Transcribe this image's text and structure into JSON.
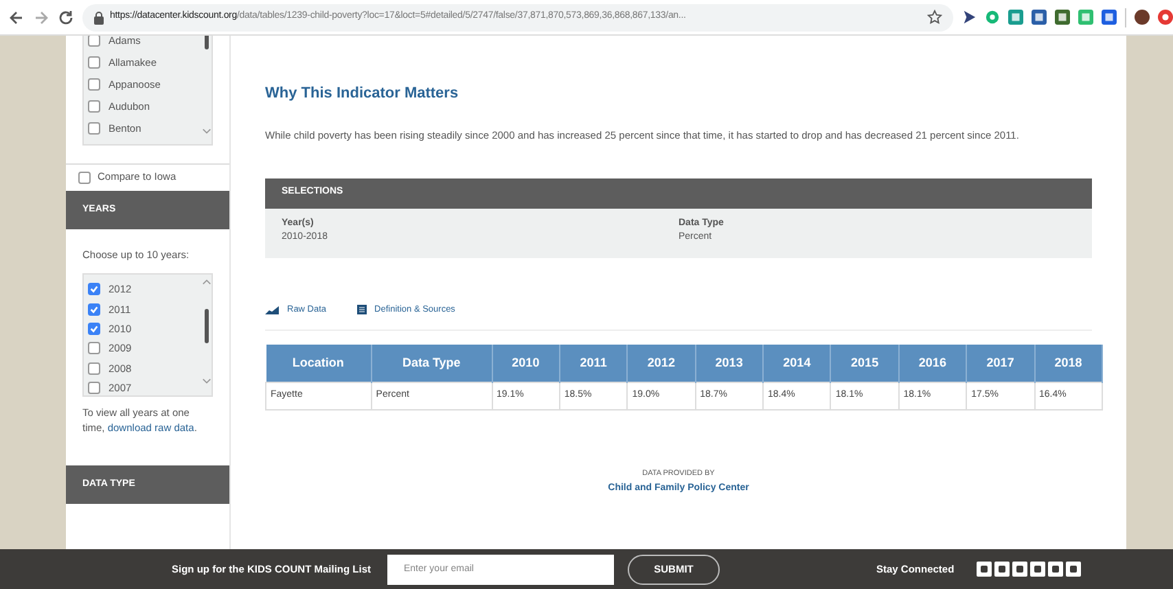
{
  "browser": {
    "url_host": "https://datacenter.kidscount.org",
    "url_path": "/data/tables/1239-child-poverty?loc=17&loct=5#detailed/5/2747/false/37,871,870,573,869,36,868,867,133/an..."
  },
  "sidebar": {
    "locations": [
      {
        "label": "Adams",
        "checked": false
      },
      {
        "label": "Allamakee",
        "checked": false
      },
      {
        "label": "Appanoose",
        "checked": false
      },
      {
        "label": "Audubon",
        "checked": false
      },
      {
        "label": "Benton",
        "checked": false
      }
    ],
    "compare": {
      "label": "Compare to Iowa",
      "checked": false
    },
    "years_header": "YEARS",
    "years_hint": "Choose up to 10 years:",
    "years": [
      {
        "label": "2012",
        "checked": true
      },
      {
        "label": "2011",
        "checked": true
      },
      {
        "label": "2010",
        "checked": true
      },
      {
        "label": "2009",
        "checked": false
      },
      {
        "label": "2008",
        "checked": false
      },
      {
        "label": "2007",
        "checked": false
      }
    ],
    "note": "To view all years at one time,",
    "note_link": "download raw data",
    "note_end": ".",
    "data_type_header": "DATA TYPE"
  },
  "main": {
    "title": "Why This Indicator Matters",
    "paragraph": "While child poverty has been rising steadily since 2000 and has increased 25 percent since that time, it has started to drop and has decreased 21 percent since 2011.",
    "selections": {
      "header": "SELECTIONS",
      "items": [
        {
          "label": "Year(s)",
          "value": "2010-2018"
        },
        {
          "label": "Data Type",
          "value": "Percent"
        }
      ]
    },
    "links": [
      {
        "kind": "chart",
        "label": "Raw Data"
      },
      {
        "kind": "doc",
        "label": "Definition & Sources"
      }
    ],
    "table": {
      "columns": [
        "Location",
        "Data Type",
        "2010",
        "2011",
        "2012",
        "2013",
        "2014",
        "2015",
        "2016",
        "2017",
        "2018"
      ],
      "rows": [
        [
          "Fayette",
          "Percent",
          "19.1%",
          "18.5%",
          "19.0%",
          "18.7%",
          "18.4%",
          "18.1%",
          "18.1%",
          "17.5%",
          "16.4%"
        ]
      ]
    },
    "provider_label": "DATA PROVIDED BY",
    "provider": "Child and Family Policy Center"
  },
  "footer": {
    "signup": "Sign up for the KIDS COUNT Mailing List",
    "email_placeholder": "Enter your email",
    "submit": "SUBMIT",
    "stay": "Stay Connected"
  }
}
